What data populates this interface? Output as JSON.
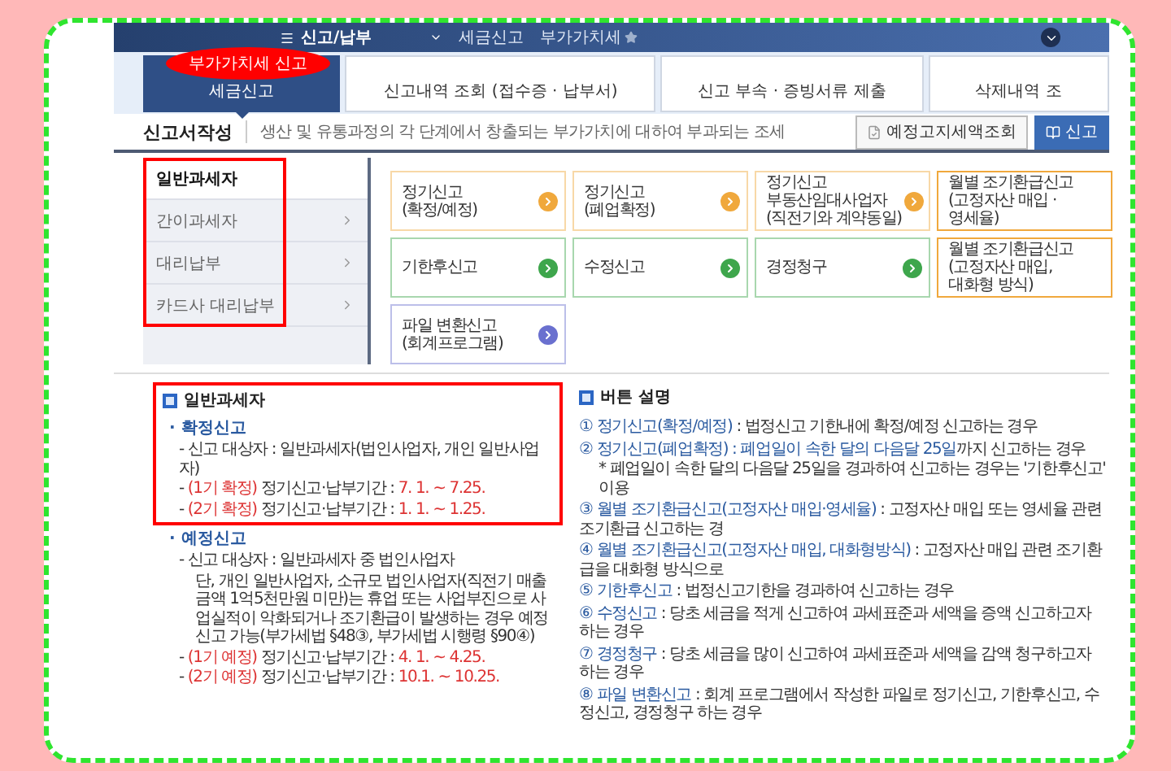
{
  "nav": {
    "menu": "신고/납부",
    "breadcrumbs": [
      {
        "label": "세금신고",
        "favorite": false
      },
      {
        "label": "부가가치세",
        "favorite": true
      }
    ]
  },
  "callout": {
    "text": "부가가치세 신고"
  },
  "tabs": [
    {
      "label": "세금신고",
      "selected": true
    },
    {
      "label": "신고내역 조회 (접수증 · 납부서)",
      "selected": false
    },
    {
      "label": "신고 부속 · 증빙서류 제출",
      "selected": false
    },
    {
      "label": "삭제내역 조",
      "selected": false
    }
  ],
  "section": {
    "title": "신고서작성",
    "subtitle": "생산 및 유통과정의 각 단계에서 창출되는 부가가치에 대하여 부과되는 조세",
    "buttons": [
      {
        "label": "예정고지세액조회",
        "kind": "outline"
      },
      {
        "label": "신고",
        "kind": "primary"
      }
    ]
  },
  "taxpayer_menu": {
    "highlighted": true,
    "items": [
      {
        "label": "일반과세자",
        "selected": true
      },
      {
        "label": "간이과세자",
        "selected": false
      },
      {
        "label": "대리납부",
        "selected": false
      },
      {
        "label": "카드사 대리납부",
        "selected": false
      }
    ]
  },
  "cards": [
    {
      "label": "정기신고\n(확정/예정)",
      "color": "#f0a83c",
      "arrow": true
    },
    {
      "label": "정기신고\n(폐업확정)",
      "color": "#f0a83c",
      "arrow": true
    },
    {
      "label": "정기신고\n부동산임대사업자\n(직전기와 계약동일)",
      "color": "#f0a83c",
      "arrow": true
    },
    {
      "label": "월별 조기환급신고\n(고정자산 매입 ·\n영세율)",
      "color": "#f0a83c",
      "arrow": false
    },
    {
      "label": "기한후신고",
      "color": "#3ea64c",
      "arrow": true
    },
    {
      "label": "수정신고",
      "color": "#3ea64c",
      "arrow": true
    },
    {
      "label": "경정청구",
      "color": "#3ea64c",
      "arrow": true
    },
    {
      "label": "월별 조기환급신고\n(고정자산 매입,\n대화형 방식)",
      "color": "#f0a83c",
      "arrow": false
    },
    {
      "label": "파일 변환신고\n(회계프로그램)",
      "color": "#6a70cf",
      "arrow": true
    }
  ],
  "info_left": {
    "title": "일반과세자",
    "highlighted": true,
    "groups": [
      {
        "title": "· 확정신고",
        "lines": [
          [
            {
              "t": "- 신고 대상자 : 일반과세자(법인사업자, 개인 일반사업자)",
              "red": false
            }
          ],
          [
            {
              "t": "- ",
              "red": false
            },
            {
              "t": "(1기 확정)",
              "red": true
            },
            {
              "t": " 정기신고·납부기간 : ",
              "red": false
            },
            {
              "t": "7. 1. ~ 7.25.",
              "red": true
            }
          ],
          [
            {
              "t": "- ",
              "red": false
            },
            {
              "t": "(2기 확정)",
              "red": true
            },
            {
              "t": " 정기신고·납부기간 : ",
              "red": false
            },
            {
              "t": "1. 1. ~ 1.25.",
              "red": true
            }
          ]
        ]
      },
      {
        "title": "· 예정신고",
        "lines": [
          [
            {
              "t": "- 신고 대상자 : 일반과세자 중 법인사업자",
              "red": false
            }
          ],
          [
            {
              "t": "단, 개인 일반사업자, 소규모 법인사업자(직전기 매출금액 1억5천만원 미만)는 휴업 또는 사업부진으로 사업실적이 악화되거나 조기환급이 발생하는 경우 예정신고 가능(부가세법 §48③, 부가세법 시행령 §90④)",
              "red": false
            }
          ],
          [
            {
              "t": "- ",
              "red": false
            },
            {
              "t": "(1기 예정)",
              "red": true
            },
            {
              "t": " 정기신고·납부기간 : ",
              "red": false
            },
            {
              "t": "4. 1. ~ 4.25.",
              "red": true
            }
          ],
          [
            {
              "t": "- ",
              "red": false
            },
            {
              "t": "(2기 예정)",
              "red": true
            },
            {
              "t": " 정기신고·납부기간 : ",
              "red": false
            },
            {
              "t": "10.1. ~ 10.25.",
              "red": true
            }
          ]
        ]
      }
    ]
  },
  "info_right": {
    "title": "버튼 설명",
    "items": [
      {
        "kind": "item",
        "num": "①",
        "parts": [
          {
            "t": "정기신고(확정/예정)",
            "accent": true
          },
          {
            "t": " : 법정신고 기한내에 확정/예정 신고하는 경우",
            "accent": false
          }
        ]
      },
      {
        "kind": "item",
        "num": "②",
        "parts": [
          {
            "t": "정기신고(폐업확정) : 폐업일이 속한 달의 다음달 25일",
            "accent": true
          },
          {
            "t": "까지 신고하는 경우",
            "accent": false
          }
        ]
      },
      {
        "kind": "note",
        "parts": [
          {
            "t": "* 폐업일이 속한 달의 다음달 25일을 경과하여 신고하는 경우는 '기한후신고' 이용",
            "accent": false
          }
        ]
      },
      {
        "kind": "item",
        "num": "③",
        "parts": [
          {
            "t": "월별 조기환급신고(고정자산 매입·영세율)",
            "accent": true
          },
          {
            "t": " : 고정자산 매입 또는 영세율 관련 조기환급 신고하는 경",
            "accent": false
          }
        ]
      },
      {
        "kind": "item",
        "num": "④",
        "parts": [
          {
            "t": "월별 조기환급신고(고정자산 매입, 대화형방식)",
            "accent": true
          },
          {
            "t": " : 고정자산 매입 관련 조기환급을 대화형 방식으로",
            "accent": false
          }
        ]
      },
      {
        "kind": "item",
        "num": "⑤",
        "parts": [
          {
            "t": "기한후신고",
            "accent": true
          },
          {
            "t": " : 법정신고기한을 경과하여 신고하는 경우",
            "accent": false
          }
        ]
      },
      {
        "kind": "item",
        "num": "⑥",
        "parts": [
          {
            "t": "수정신고",
            "accent": true
          },
          {
            "t": " : 당초 세금을 적게 신고하여 과세표준과 세액을 증액 신고하고자 하는 경우",
            "accent": false
          }
        ]
      },
      {
        "kind": "item",
        "num": "⑦",
        "parts": [
          {
            "t": "경정청구",
            "accent": true
          },
          {
            "t": " : 당초 세금을 많이 신고하여 과세표준과 세액을 감액 청구하고자 하는 경우",
            "accent": false
          }
        ]
      },
      {
        "kind": "item",
        "num": "⑧",
        "parts": [
          {
            "t": "파일 변환신고",
            "accent": true
          },
          {
            "t": " : 회계 프로그램에서 작성한 파일로 정기신고, 기한후신고, 수정신고, 경정청구 하는 경우",
            "accent": false
          }
        ]
      }
    ]
  }
}
